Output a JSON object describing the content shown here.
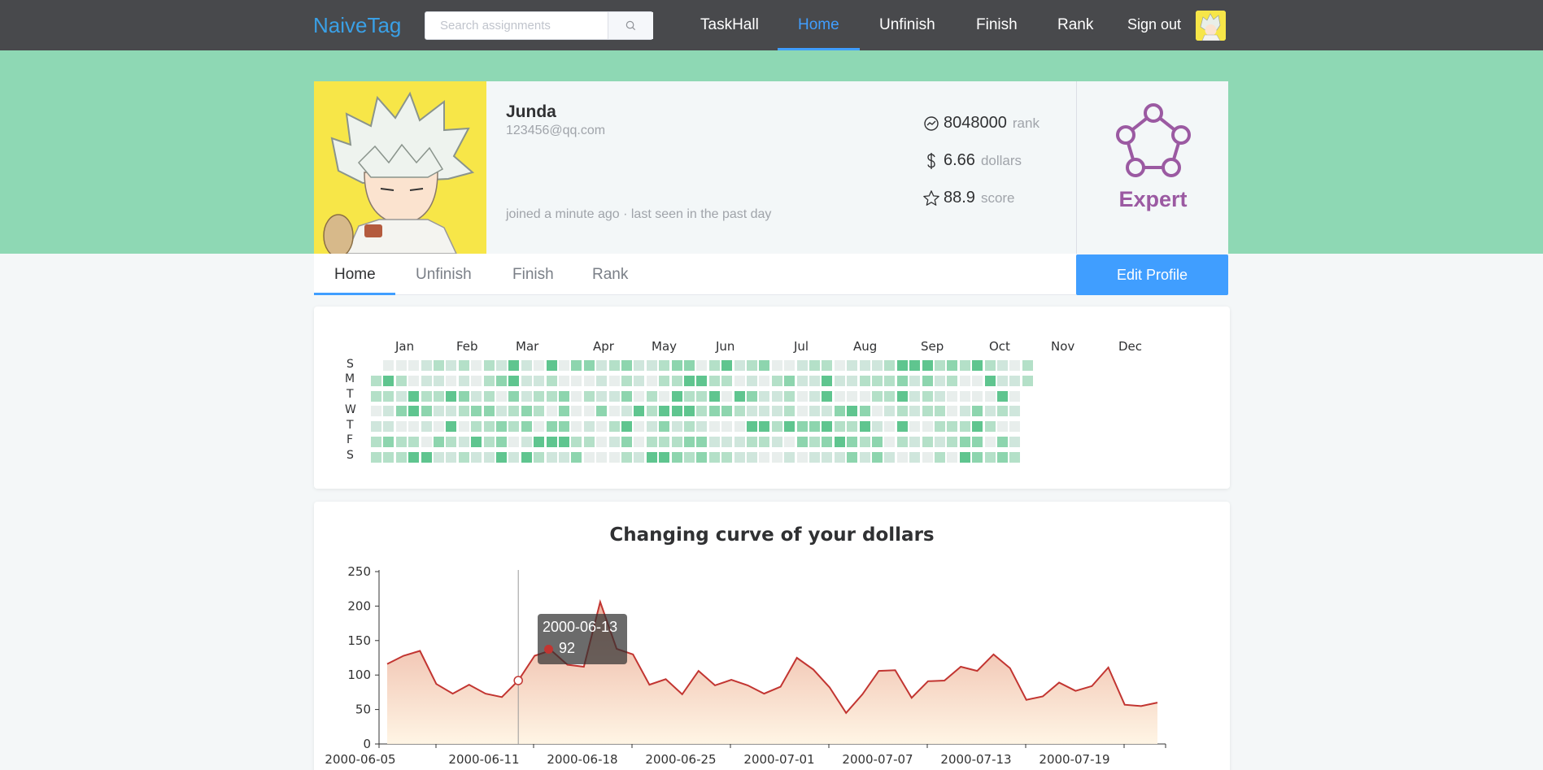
{
  "topnav": {
    "brand": "NaiveTag",
    "search_placeholder": "Search assignments",
    "links": [
      "TaskHall",
      "Home",
      "Unfinish",
      "Finish",
      "Rank"
    ],
    "active": "Home",
    "signout": "Sign out"
  },
  "profile": {
    "name": "Junda",
    "email": "123456@qq.com",
    "joined": "joined a minute ago · last seen in the past day",
    "stats": [
      {
        "icon": "trend-icon",
        "value": "8048000",
        "unit": "rank"
      },
      {
        "icon": "dollar-icon",
        "value": "6.66",
        "unit": "dollars"
      },
      {
        "icon": "star-icon",
        "value": "88.9",
        "unit": "score"
      }
    ],
    "badge": "Expert"
  },
  "tabs": {
    "items": [
      "Home",
      "Unfinish",
      "Finish",
      "Rank"
    ],
    "active": "Home",
    "edit_button": "Edit Profile"
  },
  "heatmap": {
    "months": [
      "Jan",
      "Feb",
      "Mar",
      "Apr",
      "May",
      "Jun",
      "Jul",
      "Aug",
      "Sep",
      "Oct",
      "Nov",
      "Dec"
    ],
    "days": [
      "S",
      "M",
      "T",
      "W",
      "T",
      "F",
      "S"
    ],
    "colors": [
      "#e8eeec",
      "#cfe6dc",
      "#b4e0c8",
      "#8dd5ae",
      "#5fc58f"
    ]
  },
  "chart_data": {
    "type": "area",
    "title": "Changing curve of your dollars",
    "xlabel": "",
    "ylabel": "",
    "ylim": [
      0,
      250
    ],
    "yticks": [
      0,
      50,
      100,
      150,
      200,
      250
    ],
    "xtick_labels": [
      "2000-06-05",
      "2000-06-11",
      "2000-06-18",
      "2000-06-25",
      "2000-07-01",
      "2000-07-07",
      "2000-07-13",
      "2000-07-19"
    ],
    "x_start": "2000-06-05",
    "series": [
      {
        "values": [
          116,
          128,
          135,
          87,
          73,
          86,
          73,
          68,
          92,
          128,
          136,
          115,
          112,
          206,
          138,
          130,
          86,
          94,
          72,
          106,
          85,
          93,
          85,
          73,
          83,
          125,
          108,
          82,
          45,
          72,
          106,
          107,
          67,
          91,
          92,
          112,
          106,
          130,
          110,
          64,
          69,
          89,
          77,
          84,
          111,
          57,
          55,
          60
        ],
        "color": "#c23531"
      }
    ],
    "tooltip": {
      "date": "2000-06-13",
      "value": "92"
    }
  }
}
